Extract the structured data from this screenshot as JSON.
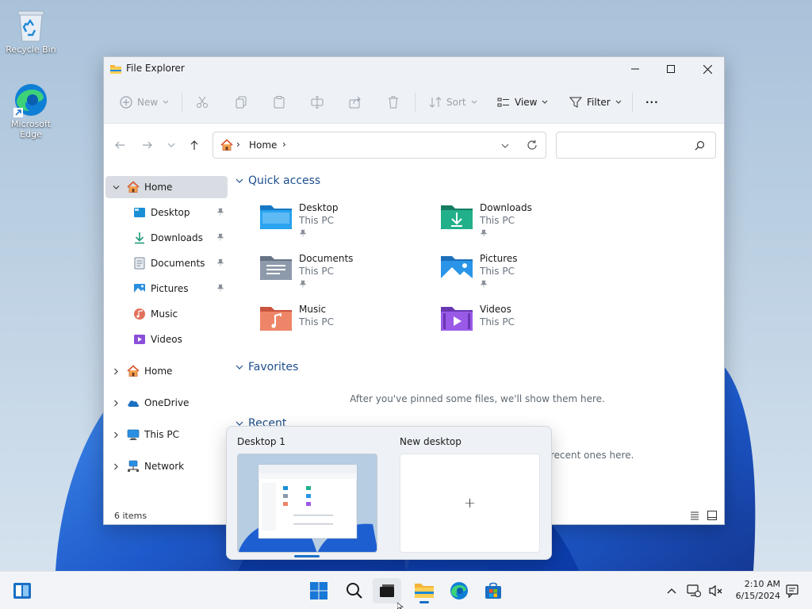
{
  "desktop": {
    "icons": [
      {
        "label": "Recycle Bin",
        "icon": "recycle-bin-icon"
      },
      {
        "label": "Microsoft Edge",
        "icon": "edge-icon"
      }
    ]
  },
  "window": {
    "title": "File Explorer",
    "toolbar": {
      "new_label": "New",
      "sort_label": "Sort",
      "view_label": "View",
      "filter_label": "Filter",
      "more_label": "···"
    },
    "address": {
      "location": "Home",
      "separator": "›",
      "search_placeholder": ""
    },
    "sidebar": {
      "items": [
        {
          "label": "Home",
          "icon": "home-icon",
          "selected": true,
          "expanded": true
        },
        {
          "label": "Desktop",
          "icon": "desktop-folder-icon",
          "pinned": true
        },
        {
          "label": "Downloads",
          "icon": "downloads-icon",
          "pinned": true
        },
        {
          "label": "Documents",
          "icon": "documents-icon",
          "pinned": true
        },
        {
          "label": "Pictures",
          "icon": "pictures-icon",
          "pinned": true
        },
        {
          "label": "Music",
          "icon": "music-icon"
        },
        {
          "label": "Videos",
          "icon": "videos-icon"
        },
        {
          "label": "Home",
          "icon": "home-icon"
        },
        {
          "label": "OneDrive",
          "icon": "onedrive-icon"
        },
        {
          "label": "This PC",
          "icon": "this-pc-icon"
        },
        {
          "label": "Network",
          "icon": "network-icon"
        }
      ]
    },
    "content": {
      "quick_access_title": "Quick access",
      "quick_access": [
        {
          "name": "Desktop",
          "location": "This PC",
          "pinned": true,
          "color": "#1b8fd6"
        },
        {
          "name": "Downloads",
          "location": "This PC",
          "pinned": true,
          "color": "#1f9a7a"
        },
        {
          "name": "Documents",
          "location": "This PC",
          "pinned": true,
          "color": "#7d8a99"
        },
        {
          "name": "Pictures",
          "location": "This PC",
          "pinned": true,
          "color": "#2a8fe0"
        },
        {
          "name": "Music",
          "location": "This PC",
          "pinned": false,
          "color": "#e2725b"
        },
        {
          "name": "Videos",
          "location": "This PC",
          "pinned": false,
          "color": "#8a4fd8"
        }
      ],
      "favorites_title": "Favorites",
      "favorites_empty": "After you've pinned some files, we'll show them here.",
      "recent_title": "Recent",
      "recent_empty_visible": "recent ones here."
    },
    "status": {
      "item_count": "6 items"
    }
  },
  "taskview": {
    "desktops": [
      {
        "label": "Desktop 1",
        "active": true
      },
      {
        "label": "New desktop",
        "add_glyph": "+"
      }
    ]
  },
  "taskbar": {
    "time": "2:10 AM",
    "date": "6/15/2024"
  },
  "colors": {
    "accent": "#1a6fc4",
    "section_header": "#1e4f8c"
  }
}
